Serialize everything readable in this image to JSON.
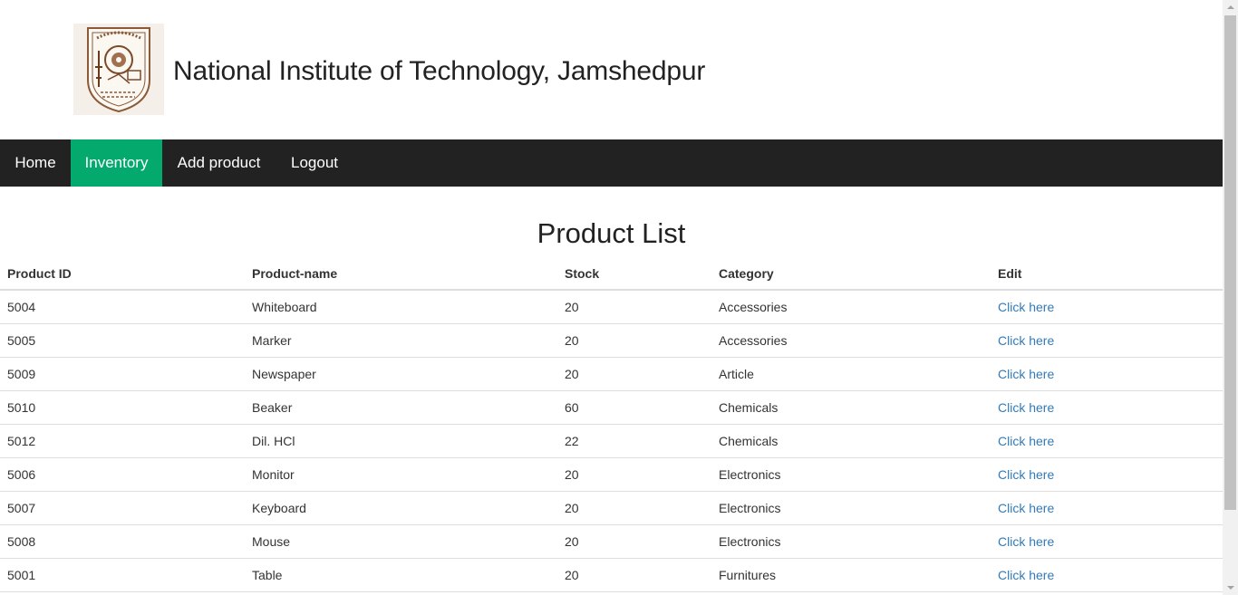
{
  "header": {
    "title": "National Institute of Technology, Jamshedpur",
    "logo_icon": "institute-emblem-icon"
  },
  "nav": {
    "items": [
      {
        "label": "Home",
        "active": false
      },
      {
        "label": "Inventory",
        "active": true
      },
      {
        "label": "Add product",
        "active": false
      },
      {
        "label": "Logout",
        "active": false
      }
    ],
    "background_color": "#222222",
    "active_color": "#04aa6d"
  },
  "main": {
    "heading": "Product List",
    "table": {
      "columns": [
        "Product ID",
        "Product-name",
        "Stock",
        "Category",
        "Edit"
      ],
      "rows": [
        {
          "id": "5004",
          "name": "Whiteboard",
          "stock": "20",
          "category": "Accessories",
          "edit": "Click here"
        },
        {
          "id": "5005",
          "name": "Marker",
          "stock": "20",
          "category": "Accessories",
          "edit": "Click here"
        },
        {
          "id": "5009",
          "name": "Newspaper",
          "stock": "20",
          "category": "Article",
          "edit": "Click here"
        },
        {
          "id": "5010",
          "name": "Beaker",
          "stock": "60",
          "category": "Chemicals",
          "edit": "Click here"
        },
        {
          "id": "5012",
          "name": "Dil. HCl",
          "stock": "22",
          "category": "Chemicals",
          "edit": "Click here"
        },
        {
          "id": "5006",
          "name": "Monitor",
          "stock": "20",
          "category": "Electronics",
          "edit": "Click here"
        },
        {
          "id": "5007",
          "name": "Keyboard",
          "stock": "20",
          "category": "Electronics",
          "edit": "Click here"
        },
        {
          "id": "5008",
          "name": "Mouse",
          "stock": "20",
          "category": "Electronics",
          "edit": "Click here"
        },
        {
          "id": "5001",
          "name": "Table",
          "stock": "20",
          "category": "Furnitures",
          "edit": "Click here"
        }
      ],
      "link_color": "#337ab7"
    }
  }
}
